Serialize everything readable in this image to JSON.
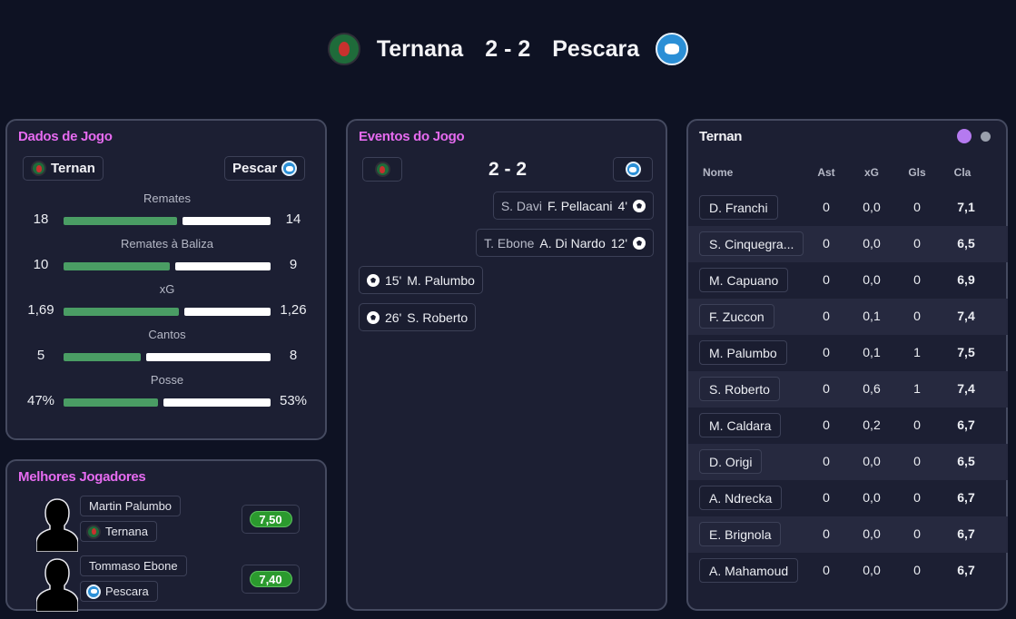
{
  "header": {
    "home_team": "Ternana",
    "away_team": "Pescara",
    "score": "2 - 2"
  },
  "stats_panel": {
    "title": "Dados de Jogo",
    "home_chip": "Ternan",
    "away_chip": "Pescar",
    "stats": [
      {
        "label": "Remates",
        "home": "18",
        "away": "14",
        "home_share": 0.5625
      },
      {
        "label": "Remates à Baliza",
        "home": "10",
        "away": "9",
        "home_share": 0.5263
      },
      {
        "label": "xG",
        "home": "1,69",
        "away": "1,26",
        "home_share": 0.5729
      },
      {
        "label": "Cantos",
        "home": "5",
        "away": "8",
        "home_share": 0.3846
      },
      {
        "label": "Posse",
        "home": "47%",
        "away": "53%",
        "home_share": 0.47
      }
    ]
  },
  "best_players": {
    "title": "Melhores Jogadores",
    "players": [
      {
        "name": "Martin Palumbo",
        "team": "Ternana",
        "rating": "7,50"
      },
      {
        "name": "Tommaso Ebone",
        "team": "Pescara",
        "rating": "7,40"
      }
    ]
  },
  "events": {
    "title": "Eventos do Jogo",
    "score": "2 - 2",
    "items": [
      {
        "side": "away",
        "assist": "S. Davi",
        "scorer": "F. Pellacani",
        "minute": "4'"
      },
      {
        "side": "away",
        "assist": "T. Ebone",
        "scorer": "A. Di Nardo",
        "minute": "12'"
      },
      {
        "side": "home",
        "minute": "15'",
        "scorer": "M. Palumbo"
      },
      {
        "side": "home",
        "minute": "26'",
        "scorer": "S. Roberto"
      }
    ]
  },
  "lineup": {
    "title": "Ternan",
    "toggle_colors": {
      "active": "#b57af0",
      "inactive": "#9aa0ad"
    },
    "columns": [
      "Nome",
      "Ast",
      "xG",
      "Gls",
      "Cla"
    ],
    "rows": [
      {
        "name": "D. Franchi",
        "ast": "0",
        "xg": "0,0",
        "gls": "0",
        "cla": "7,1"
      },
      {
        "name": "S. Cinquegra...",
        "ast": "0",
        "xg": "0,0",
        "gls": "0",
        "cla": "6,5"
      },
      {
        "name": "M. Capuano",
        "ast": "0",
        "xg": "0,0",
        "gls": "0",
        "cla": "6,9"
      },
      {
        "name": "F. Zuccon",
        "ast": "0",
        "xg": "0,1",
        "gls": "0",
        "cla": "7,4"
      },
      {
        "name": "M. Palumbo",
        "ast": "0",
        "xg": "0,1",
        "gls": "1",
        "cla": "7,5"
      },
      {
        "name": "S. Roberto",
        "ast": "0",
        "xg": "0,6",
        "gls": "1",
        "cla": "7,4"
      },
      {
        "name": "M. Caldara",
        "ast": "0",
        "xg": "0,2",
        "gls": "0",
        "cla": "6,7"
      },
      {
        "name": "D. Origi",
        "ast": "0",
        "xg": "0,0",
        "gls": "0",
        "cla": "6,5"
      },
      {
        "name": "A. Ndrecka",
        "ast": "0",
        "xg": "0,0",
        "gls": "0",
        "cla": "6,7"
      },
      {
        "name": "E. Brignola",
        "ast": "0",
        "xg": "0,0",
        "gls": "0",
        "cla": "6,7"
      },
      {
        "name": "A. Mahamoud",
        "ast": "0",
        "xg": "0,0",
        "gls": "0",
        "cla": "6,7"
      }
    ]
  },
  "icons": {
    "home_crest": "ternana-crest-icon",
    "away_crest": "pescara-crest-icon",
    "goal": "soccer-ball-icon",
    "player_avatar": "player-silhouette-icon"
  }
}
